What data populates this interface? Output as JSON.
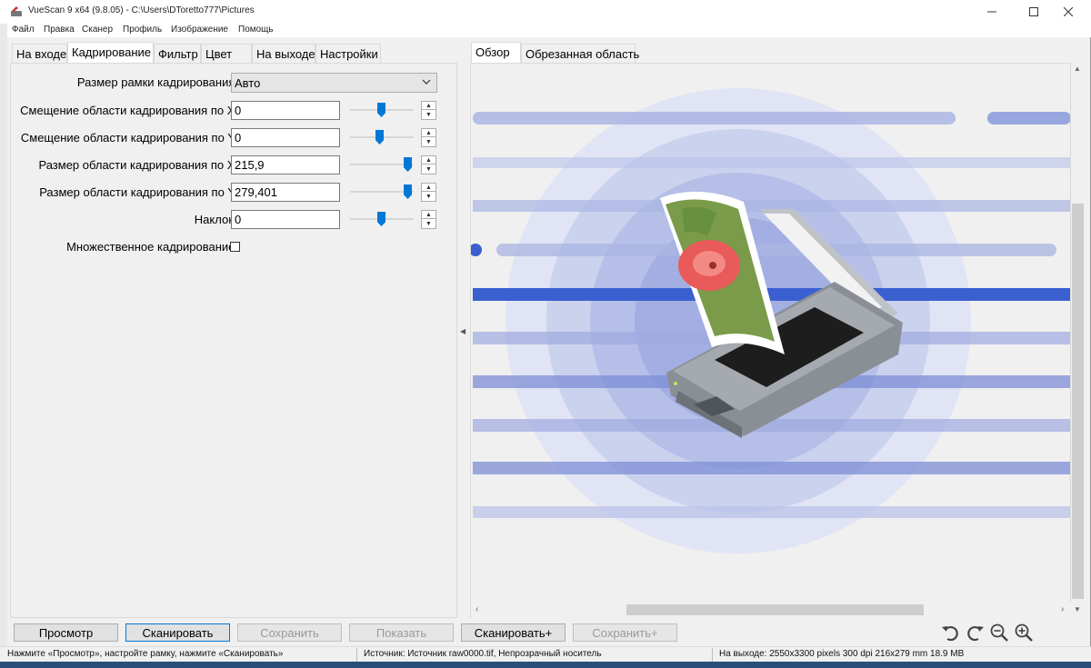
{
  "window": {
    "title": "VueScan 9 x64 (9.8.05) - C:\\Users\\DToretto777\\Pictures"
  },
  "menu": [
    "Файл",
    "Правка",
    "Сканер",
    "Профиль",
    "Изображение",
    "Помощь"
  ],
  "left_tabs": [
    "На входе",
    "Кадрирование",
    "Фильтр",
    "Цвет",
    "На выходе",
    "Настройки"
  ],
  "left_active_tab": "Кадрирование",
  "crop": {
    "frame_size_label": "Размер рамки кадрирования:",
    "frame_size_value": "Авто",
    "offset_x_label": "Смещение области кадрирования по X:",
    "offset_x_value": "0",
    "offset_y_label": "Смещение области кадрирования по Y:",
    "offset_y_value": "0",
    "size_x_label": "Размер области кадрирования по X:",
    "size_x_value": "215,9",
    "size_y_label": "Размер области кадрирования по Y:",
    "size_y_value": "279,401",
    "tilt_label": "Наклон:",
    "tilt_value": "0",
    "multi_label": "Множественное кадрирование:",
    "multi_checked": false
  },
  "right_tabs": [
    "Обзор",
    "Обрезанная область"
  ],
  "right_active_tab": "Обзор",
  "buttons": {
    "preview": "Просмотр",
    "scan": "Сканировать",
    "save": "Сохранить",
    "show": "Показать",
    "scan_plus": "Сканировать+",
    "save_plus": "Сохранить+"
  },
  "status": {
    "hint": "Нажмите «Просмотр», настройте рамку, нажмите «Сканировать»",
    "source": "Источник: Источник raw0000.tif, Непрозрачный носитель",
    "output": "На выходе: 2550x3300 pixels 300 dpi 216x279 mm 18.9 MB"
  },
  "colors": {
    "accent": "#0078d7",
    "preview_blue": "#3a5fd0",
    "preview_light": "#c9d0ee"
  },
  "icons": [
    "app-icon",
    "minimize-icon",
    "maximize-icon",
    "close-icon",
    "rotate-left-icon",
    "rotate-right-icon",
    "zoom-out-icon",
    "zoom-in-icon",
    "chevron-down-icon",
    "collapse-arrow-icon"
  ]
}
